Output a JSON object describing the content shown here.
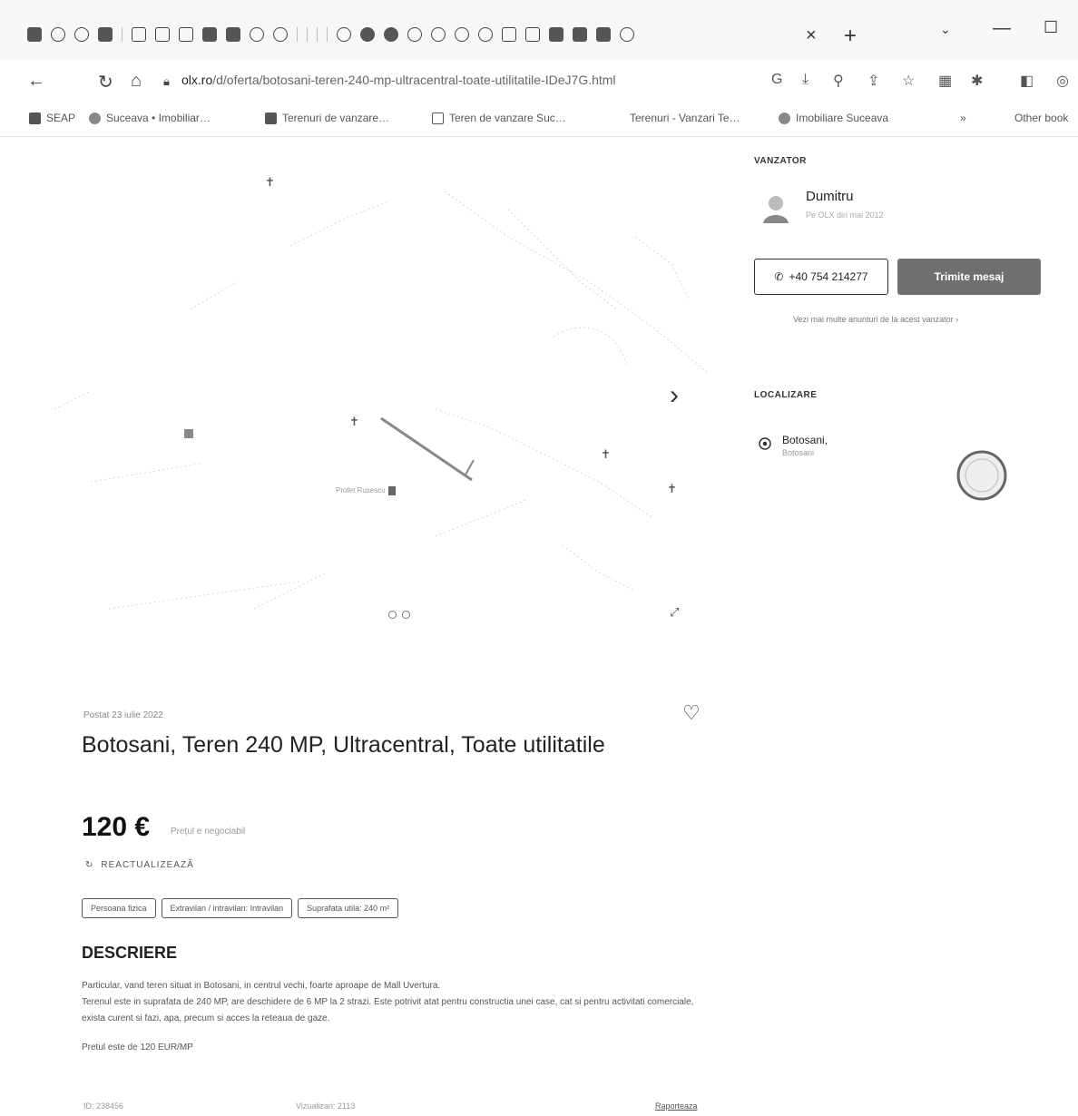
{
  "browser": {
    "tab_close": "×",
    "new_tab": "+",
    "address": {
      "host": "olx.ro",
      "path": "/d/oferta/botosani-teren-240-mp-ultracentral-toate-utilitatile-IDeJ7G.html"
    },
    "bookmarks": [
      {
        "label": "SEAP",
        "icon": "bookmark-icon"
      },
      {
        "label": "Suceava • Imobiliar…",
        "icon": "globe-icon"
      },
      {
        "label": "Terenuri de vanzare…",
        "icon": "grid-icon"
      },
      {
        "label": "Teren de vanzare Suc…",
        "icon": "p-icon"
      },
      {
        "label": "Terenuri - Vanzari Te…",
        "icon": "none"
      },
      {
        "label": "Imobiliare Suceava",
        "icon": "globe-icon"
      },
      {
        "label": "»",
        "icon": "none"
      },
      {
        "label": "Other book",
        "icon": "folder-icon"
      }
    ]
  },
  "map": {
    "labels": [
      "Profet Rusescu"
    ],
    "next_arrow": "›",
    "expand": "⤢"
  },
  "ad": {
    "posted": "Postat 23 iulie 2022",
    "title": "Botosani, Teren 240 MP, Ultracentral, Toate utilitatile",
    "price": "120 €",
    "price_note": "Prețul e negociabil",
    "refresh": "REACTUALIZEAZĂ",
    "tags": [
      "Persoana fizica",
      "Extravilan / intravilan: Intravilan",
      "Suprafata utila: 240 m²"
    ],
    "description_heading": "DESCRIERE",
    "description": [
      "Particular, vand teren situat in Botosani, in centrul vechi, foarte aproape de Mall Uvertura.",
      "Terenul este in suprafata de 240 MP, are deschidere de 6 MP la 2 strazi. Este potrivit atat pentru constructia unei case, cat si pentru activitati comerciale, exista curent si fazi, apa, precum si acces la reteaua de gaze.",
      "Pretul este de 120 EUR/MP"
    ],
    "footer": {
      "id": "ID: 238456",
      "views": "Vizualizari: 2113",
      "report": "Raporteaza"
    }
  },
  "seller": {
    "heading": "VANZATOR",
    "name": "Dumitru",
    "subtitle": "Pe OLX din mai 2012",
    "phone": "+40 754 214277",
    "message_button": "Trimite mesaj",
    "more_ads": "Vezi mai multe anunturi de la acest vanzator ›"
  },
  "location": {
    "heading": "LOCALIZARE",
    "city": "Botosani,",
    "region": "Botosani"
  }
}
